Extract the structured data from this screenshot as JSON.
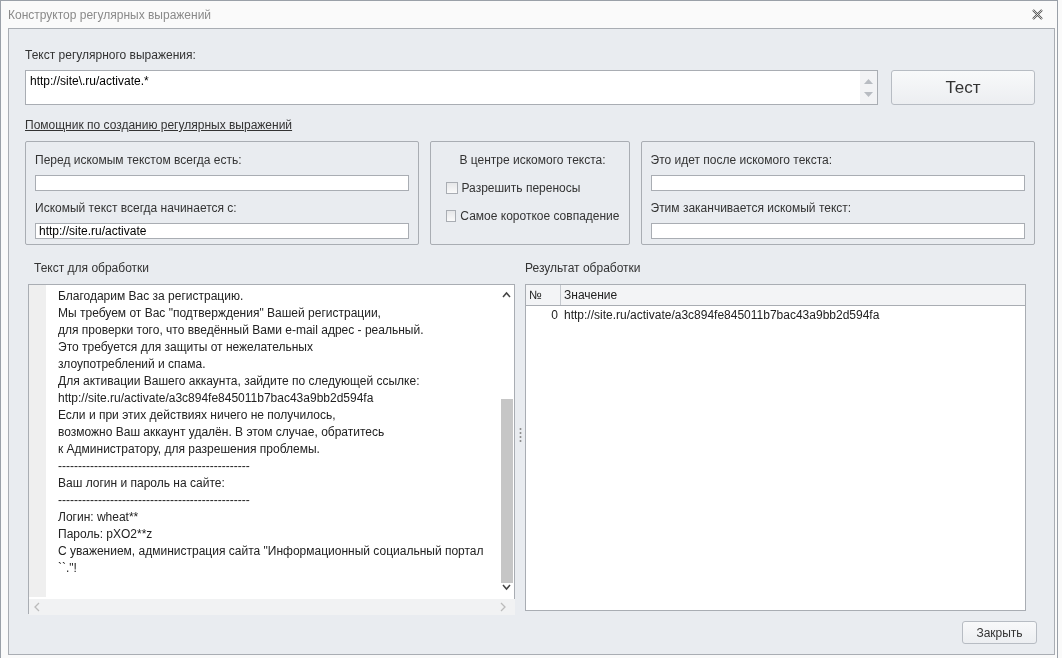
{
  "window": {
    "title": "Конструктор регулярных выражений"
  },
  "regex": {
    "label": "Текст регулярного выражения:",
    "value": "http://site\\.ru/activate.*"
  },
  "test_button": "Тест",
  "helper_link": "Помощник по созданию регулярных выражений",
  "before_group": {
    "fields": [
      {
        "label": "Перед искомым текстом всегда есть:"
      },
      {
        "label": "Искомый текст всегда начинается с:",
        "value": "http://site.ru/activate"
      }
    ]
  },
  "center_group": {
    "title": "В центре искомого текста:",
    "checkboxes": [
      {
        "label": "Разрешить переносы",
        "checked": false
      },
      {
        "label": "Самое короткое совпадение",
        "checked": false
      }
    ]
  },
  "after_group": {
    "fields": [
      {
        "label": "Это идет после искомого текста:"
      },
      {
        "label": "Этим заканчивается искомый текст:"
      }
    ]
  },
  "source": {
    "label": "Текст для обработки",
    "lines": [
      "Благодарим Вас за регистрацию.",
      "Мы требуем от Вас \"подтверждения\" Вашей регистрации,",
      "для проверки того, что введённый Вами e-mail адрес - реальный.",
      "Это требуется для защиты от нежелательных",
      "злоупотреблений и спама.",
      "Для активации Вашего аккаунта, зайдите по следующей ссылке:",
      "http://site.ru/activate/a3c894fe845011b7bac43a9bb2d594fa",
      "Если и при этих действиях ничего не получилось,",
      "возможно Ваш аккаунт удалён. В этом случае, обратитесь",
      "к Администратору, для разрешения проблемы.",
      "------------------------------------------------",
      "Ваш логин и пароль на сайте:",
      "------------------------------------------------",
      "Логин: wheat**",
      "Пароль: pXO2**z",
      "С уважением, администрация сайта \"Информационный социальный портал",
      "``.\"!"
    ]
  },
  "result": {
    "label": "Результат обработки",
    "columns": [
      "№",
      "Значение"
    ],
    "rows": [
      [
        "0",
        "http://site.ru/activate/a3c894fe845011b7bac43a9bb2d594fa"
      ]
    ]
  },
  "close_button": "Закрыть"
}
